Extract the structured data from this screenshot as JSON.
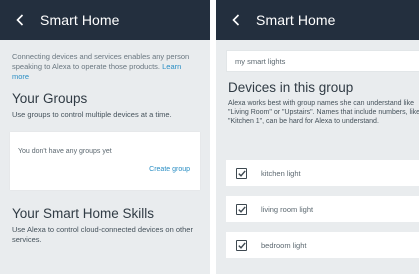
{
  "left_screen": {
    "title": "Smart Home",
    "intro": "Connecting devices and services enables any person speaking to Alexa to operate those products.",
    "learn_more": "Learn more",
    "groups": {
      "heading": "Your Groups",
      "description": "Use groups to control multiple devices at a time.",
      "empty_text": "You don't have any groups yet",
      "create_label": "Create group"
    },
    "skills": {
      "heading": "Your Smart Home Skills",
      "description": "Use Alexa to control cloud-connected devices on other services."
    }
  },
  "right_screen": {
    "title": "Smart Home",
    "group_name_value": "my smart lights",
    "devices_heading": "Devices in this group",
    "devices_description": "Alexa works best with group names she can understand like \"Living Room\" or \"Upstairs\". Names that include numbers, like \"Kitchen 1\", can be hard for Alexa to understand.",
    "devices": [
      {
        "label": "kitchen light",
        "checked": true
      },
      {
        "label": "living room light",
        "checked": true
      },
      {
        "label": "bedroom light",
        "checked": true
      }
    ]
  },
  "colors": {
    "header_bg": "#232f3e",
    "link": "#2a8ec4",
    "page_bg": "#e9ecee"
  },
  "icons": {
    "back": "chevron-left-icon",
    "checkbox": "checkmark-icon"
  }
}
